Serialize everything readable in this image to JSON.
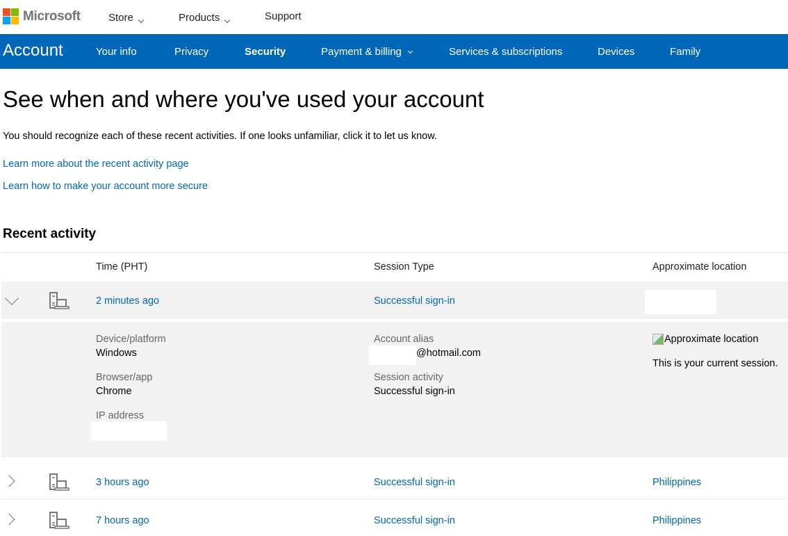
{
  "brand": {
    "name": "Microsoft",
    "logo_colors": [
      "#f25022",
      "#7fba00",
      "#00a4ef",
      "#ffb900"
    ],
    "accent": "#0067b8"
  },
  "topnav": {
    "items": [
      {
        "label": "Store",
        "has_dropdown": true
      },
      {
        "label": "Products",
        "has_dropdown": true
      },
      {
        "label": "Support",
        "has_dropdown": false
      }
    ]
  },
  "account_nav": {
    "title": "Account",
    "items": [
      {
        "label": "Your info",
        "active": false
      },
      {
        "label": "Privacy",
        "active": false
      },
      {
        "label": "Security",
        "active": true
      },
      {
        "label": "Payment & billing",
        "active": false,
        "has_dropdown": true
      },
      {
        "label": "Services & subscriptions",
        "active": false
      },
      {
        "label": "Devices",
        "active": false
      },
      {
        "label": "Family",
        "active": false
      }
    ]
  },
  "page": {
    "title": "See when and where you've used your account",
    "intro": "You should recognize each of these recent activities. If one looks unfamiliar, click it to let us know.",
    "links": [
      "Learn more about the recent activity page",
      "Learn how to make your account more secure"
    ]
  },
  "recent_activity": {
    "section_title": "Recent activity",
    "columns": [
      "Time (PHT)",
      "Session Type",
      "Approximate location"
    ],
    "rows": [
      {
        "expanded": true,
        "device_icon": "desktop-laptop-icon",
        "time": "2 minutes ago",
        "session_type": "Successful sign-in",
        "location": "",
        "details": {
          "device_platform_label": "Device/platform",
          "device_platform": "Windows",
          "browser_app_label": "Browser/app",
          "browser_app": "Chrome",
          "ip_address_label": "IP address",
          "ip_address": "",
          "account_alias_label": "Account alias",
          "account_alias_domain": "@hotmail.com",
          "session_activity_label": "Session activity",
          "session_activity": "Successful sign-in",
          "map_alt": "Approximate location",
          "current_session_note": "This is your current session."
        }
      },
      {
        "expanded": false,
        "device_icon": "desktop-laptop-icon",
        "time": "3 hours ago",
        "session_type": "Successful sign-in",
        "location": "Philippines"
      },
      {
        "expanded": false,
        "device_icon": "desktop-laptop-icon",
        "time": "7 hours ago",
        "session_type": "Successful sign-in",
        "location": "Philippines"
      }
    ]
  }
}
